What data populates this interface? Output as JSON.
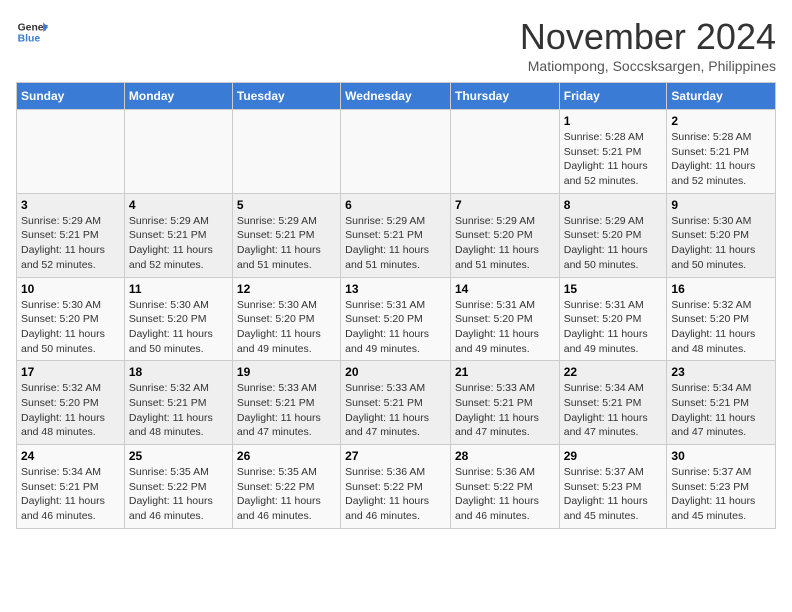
{
  "header": {
    "logo_line1": "General",
    "logo_line2": "Blue",
    "month": "November 2024",
    "location": "Matiompong, Soccsksargen, Philippines"
  },
  "weekdays": [
    "Sunday",
    "Monday",
    "Tuesday",
    "Wednesday",
    "Thursday",
    "Friday",
    "Saturday"
  ],
  "weeks": [
    [
      {
        "day": "",
        "info": ""
      },
      {
        "day": "",
        "info": ""
      },
      {
        "day": "",
        "info": ""
      },
      {
        "day": "",
        "info": ""
      },
      {
        "day": "",
        "info": ""
      },
      {
        "day": "1",
        "info": "Sunrise: 5:28 AM\nSunset: 5:21 PM\nDaylight: 11 hours\nand 52 minutes."
      },
      {
        "day": "2",
        "info": "Sunrise: 5:28 AM\nSunset: 5:21 PM\nDaylight: 11 hours\nand 52 minutes."
      }
    ],
    [
      {
        "day": "3",
        "info": "Sunrise: 5:29 AM\nSunset: 5:21 PM\nDaylight: 11 hours\nand 52 minutes."
      },
      {
        "day": "4",
        "info": "Sunrise: 5:29 AM\nSunset: 5:21 PM\nDaylight: 11 hours\nand 52 minutes."
      },
      {
        "day": "5",
        "info": "Sunrise: 5:29 AM\nSunset: 5:21 PM\nDaylight: 11 hours\nand 51 minutes."
      },
      {
        "day": "6",
        "info": "Sunrise: 5:29 AM\nSunset: 5:21 PM\nDaylight: 11 hours\nand 51 minutes."
      },
      {
        "day": "7",
        "info": "Sunrise: 5:29 AM\nSunset: 5:20 PM\nDaylight: 11 hours\nand 51 minutes."
      },
      {
        "day": "8",
        "info": "Sunrise: 5:29 AM\nSunset: 5:20 PM\nDaylight: 11 hours\nand 50 minutes."
      },
      {
        "day": "9",
        "info": "Sunrise: 5:30 AM\nSunset: 5:20 PM\nDaylight: 11 hours\nand 50 minutes."
      }
    ],
    [
      {
        "day": "10",
        "info": "Sunrise: 5:30 AM\nSunset: 5:20 PM\nDaylight: 11 hours\nand 50 minutes."
      },
      {
        "day": "11",
        "info": "Sunrise: 5:30 AM\nSunset: 5:20 PM\nDaylight: 11 hours\nand 50 minutes."
      },
      {
        "day": "12",
        "info": "Sunrise: 5:30 AM\nSunset: 5:20 PM\nDaylight: 11 hours\nand 49 minutes."
      },
      {
        "day": "13",
        "info": "Sunrise: 5:31 AM\nSunset: 5:20 PM\nDaylight: 11 hours\nand 49 minutes."
      },
      {
        "day": "14",
        "info": "Sunrise: 5:31 AM\nSunset: 5:20 PM\nDaylight: 11 hours\nand 49 minutes."
      },
      {
        "day": "15",
        "info": "Sunrise: 5:31 AM\nSunset: 5:20 PM\nDaylight: 11 hours\nand 49 minutes."
      },
      {
        "day": "16",
        "info": "Sunrise: 5:32 AM\nSunset: 5:20 PM\nDaylight: 11 hours\nand 48 minutes."
      }
    ],
    [
      {
        "day": "17",
        "info": "Sunrise: 5:32 AM\nSunset: 5:20 PM\nDaylight: 11 hours\nand 48 minutes."
      },
      {
        "day": "18",
        "info": "Sunrise: 5:32 AM\nSunset: 5:21 PM\nDaylight: 11 hours\nand 48 minutes."
      },
      {
        "day": "19",
        "info": "Sunrise: 5:33 AM\nSunset: 5:21 PM\nDaylight: 11 hours\nand 47 minutes."
      },
      {
        "day": "20",
        "info": "Sunrise: 5:33 AM\nSunset: 5:21 PM\nDaylight: 11 hours\nand 47 minutes."
      },
      {
        "day": "21",
        "info": "Sunrise: 5:33 AM\nSunset: 5:21 PM\nDaylight: 11 hours\nand 47 minutes."
      },
      {
        "day": "22",
        "info": "Sunrise: 5:34 AM\nSunset: 5:21 PM\nDaylight: 11 hours\nand 47 minutes."
      },
      {
        "day": "23",
        "info": "Sunrise: 5:34 AM\nSunset: 5:21 PM\nDaylight: 11 hours\nand 47 minutes."
      }
    ],
    [
      {
        "day": "24",
        "info": "Sunrise: 5:34 AM\nSunset: 5:21 PM\nDaylight: 11 hours\nand 46 minutes."
      },
      {
        "day": "25",
        "info": "Sunrise: 5:35 AM\nSunset: 5:22 PM\nDaylight: 11 hours\nand 46 minutes."
      },
      {
        "day": "26",
        "info": "Sunrise: 5:35 AM\nSunset: 5:22 PM\nDaylight: 11 hours\nand 46 minutes."
      },
      {
        "day": "27",
        "info": "Sunrise: 5:36 AM\nSunset: 5:22 PM\nDaylight: 11 hours\nand 46 minutes."
      },
      {
        "day": "28",
        "info": "Sunrise: 5:36 AM\nSunset: 5:22 PM\nDaylight: 11 hours\nand 46 minutes."
      },
      {
        "day": "29",
        "info": "Sunrise: 5:37 AM\nSunset: 5:23 PM\nDaylight: 11 hours\nand 45 minutes."
      },
      {
        "day": "30",
        "info": "Sunrise: 5:37 AM\nSunset: 5:23 PM\nDaylight: 11 hours\nand 45 minutes."
      }
    ]
  ]
}
